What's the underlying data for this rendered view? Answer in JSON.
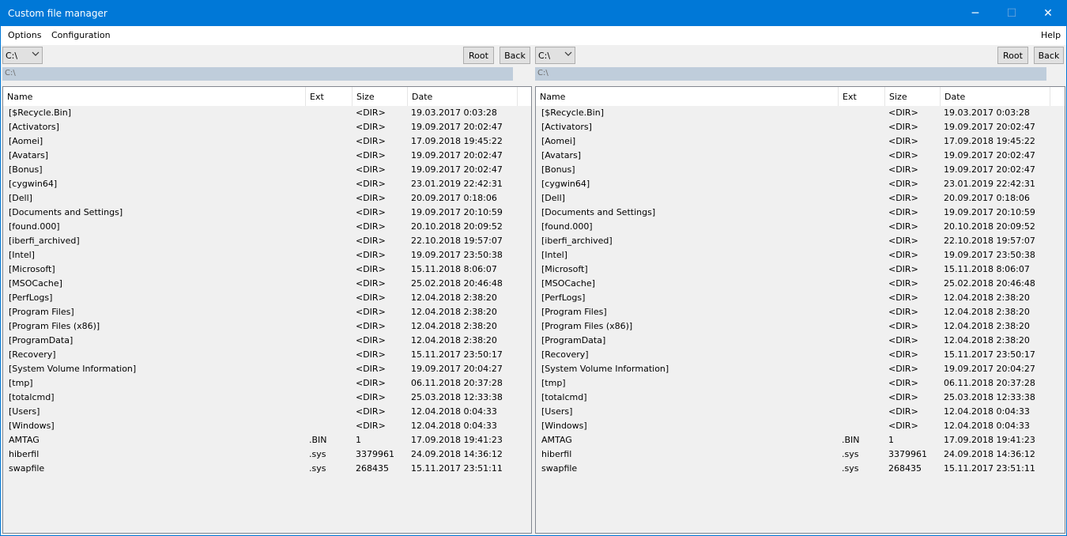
{
  "window": {
    "title": "Custom file manager",
    "controls": [
      "─",
      "☐",
      "✕"
    ]
  },
  "menu": {
    "options": "Options",
    "configuration": "Configuration",
    "help": "Help"
  },
  "panels": [
    {
      "drive": "C:\\",
      "root_label": "Root",
      "back_label": "Back",
      "path": "C:\\",
      "columns": [
        "Name",
        "Ext",
        "Size",
        "Date"
      ],
      "rows": [
        [
          "[$Recycle.Bin]",
          "",
          "<DIR>",
          "19.03.2017 0:03:28"
        ],
        [
          "[Activators]",
          "",
          "<DIR>",
          "19.09.2017 20:02:47"
        ],
        [
          "[Aomei]",
          "",
          "<DIR>",
          "17.09.2018 19:45:22"
        ],
        [
          "[Avatars]",
          "",
          "<DIR>",
          "19.09.2017 20:02:47"
        ],
        [
          "[Bonus]",
          "",
          "<DIR>",
          "19.09.2017 20:02:47"
        ],
        [
          "[cygwin64]",
          "",
          "<DIR>",
          "23.01.2019 22:42:31"
        ],
        [
          "[Dell]",
          "",
          "<DIR>",
          "20.09.2017 0:18:06"
        ],
        [
          "[Documents and Settings]",
          "",
          "<DIR>",
          "19.09.2017 20:10:59"
        ],
        [
          "[found.000]",
          "",
          "<DIR>",
          "20.10.2018 20:09:52"
        ],
        [
          "[iberfi_archived]",
          "",
          "<DIR>",
          "22.10.2018 19:57:07"
        ],
        [
          "[Intel]",
          "",
          "<DIR>",
          "19.09.2017 23:50:38"
        ],
        [
          "[Microsoft]",
          "",
          "<DIR>",
          "15.11.2018 8:06:07"
        ],
        [
          "[MSOCache]",
          "",
          "<DIR>",
          "25.02.2018 20:46:48"
        ],
        [
          "[PerfLogs]",
          "",
          "<DIR>",
          "12.04.2018 2:38:20"
        ],
        [
          "[Program Files]",
          "",
          "<DIR>",
          "12.04.2018 2:38:20"
        ],
        [
          "[Program Files (x86)]",
          "",
          "<DIR>",
          "12.04.2018 2:38:20"
        ],
        [
          "[ProgramData]",
          "",
          "<DIR>",
          "12.04.2018 2:38:20"
        ],
        [
          "[Recovery]",
          "",
          "<DIR>",
          "15.11.2017 23:50:17"
        ],
        [
          "[System Volume Information]",
          "",
          "<DIR>",
          "19.09.2017 20:04:27"
        ],
        [
          "[tmp]",
          "",
          "<DIR>",
          "06.11.2018 20:37:28"
        ],
        [
          "[totalcmd]",
          "",
          "<DIR>",
          "25.03.2018 12:33:38"
        ],
        [
          "[Users]",
          "",
          "<DIR>",
          "12.04.2018 0:04:33"
        ],
        [
          "[Windows]",
          "",
          "<DIR>",
          "12.04.2018 0:04:33"
        ],
        [
          "AMTAG",
          ".BIN",
          "1",
          "17.09.2018 19:41:23"
        ],
        [
          "hiberfil",
          ".sys",
          "3379961",
          "24.09.2018 14:36:12"
        ],
        [
          "swapfile",
          ".sys",
          "268435",
          "15.11.2017 23:51:11"
        ]
      ]
    },
    {
      "drive": "C:\\",
      "root_label": "Root",
      "back_label": "Back",
      "path": "C:\\",
      "columns": [
        "Name",
        "Ext",
        "Size",
        "Date"
      ],
      "rows": [
        [
          "[$Recycle.Bin]",
          "",
          "<DIR>",
          "19.03.2017 0:03:28"
        ],
        [
          "[Activators]",
          "",
          "<DIR>",
          "19.09.2017 20:02:47"
        ],
        [
          "[Aomei]",
          "",
          "<DIR>",
          "17.09.2018 19:45:22"
        ],
        [
          "[Avatars]",
          "",
          "<DIR>",
          "19.09.2017 20:02:47"
        ],
        [
          "[Bonus]",
          "",
          "<DIR>",
          "19.09.2017 20:02:47"
        ],
        [
          "[cygwin64]",
          "",
          "<DIR>",
          "23.01.2019 22:42:31"
        ],
        [
          "[Dell]",
          "",
          "<DIR>",
          "20.09.2017 0:18:06"
        ],
        [
          "[Documents and Settings]",
          "",
          "<DIR>",
          "19.09.2017 20:10:59"
        ],
        [
          "[found.000]",
          "",
          "<DIR>",
          "20.10.2018 20:09:52"
        ],
        [
          "[iberfi_archived]",
          "",
          "<DIR>",
          "22.10.2018 19:57:07"
        ],
        [
          "[Intel]",
          "",
          "<DIR>",
          "19.09.2017 23:50:38"
        ],
        [
          "[Microsoft]",
          "",
          "<DIR>",
          "15.11.2018 8:06:07"
        ],
        [
          "[MSOCache]",
          "",
          "<DIR>",
          "25.02.2018 20:46:48"
        ],
        [
          "[PerfLogs]",
          "",
          "<DIR>",
          "12.04.2018 2:38:20"
        ],
        [
          "[Program Files]",
          "",
          "<DIR>",
          "12.04.2018 2:38:20"
        ],
        [
          "[Program Files (x86)]",
          "",
          "<DIR>",
          "12.04.2018 2:38:20"
        ],
        [
          "[ProgramData]",
          "",
          "<DIR>",
          "12.04.2018 2:38:20"
        ],
        [
          "[Recovery]",
          "",
          "<DIR>",
          "15.11.2017 23:50:17"
        ],
        [
          "[System Volume Information]",
          "",
          "<DIR>",
          "19.09.2017 20:04:27"
        ],
        [
          "[tmp]",
          "",
          "<DIR>",
          "06.11.2018 20:37:28"
        ],
        [
          "[totalcmd]",
          "",
          "<DIR>",
          "25.03.2018 12:33:38"
        ],
        [
          "[Users]",
          "",
          "<DIR>",
          "12.04.2018 0:04:33"
        ],
        [
          "[Windows]",
          "",
          "<DIR>",
          "12.04.2018 0:04:33"
        ],
        [
          "AMTAG",
          ".BIN",
          "1",
          "17.09.2018 19:41:23"
        ],
        [
          "hiberfil",
          ".sys",
          "3379961",
          "24.09.2018 14:36:12"
        ],
        [
          "swapfile",
          ".sys",
          "268435",
          "15.11.2017 23:51:11"
        ]
      ]
    }
  ]
}
